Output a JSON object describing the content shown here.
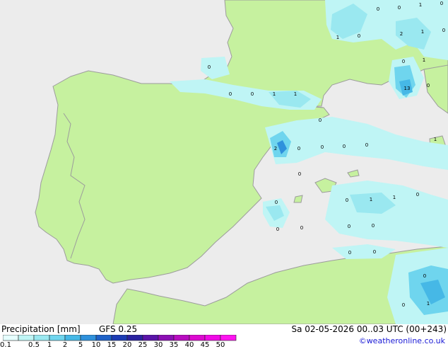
{
  "legend": {
    "title": "Precipitation [mm]",
    "model": "GFS 0.25",
    "colors": [
      "#e6ffff",
      "#bff5f5",
      "#9ae8f0",
      "#6fd5ee",
      "#46b8e6",
      "#2f91dc",
      "#1e62c8",
      "#1c3cb4",
      "#2a22a0",
      "#5a14a8",
      "#8c0fb4",
      "#b80cc0",
      "#dc0ad0",
      "#f00ae6",
      "#ff14f0"
    ],
    "ticks": [
      "0.1",
      "0.5",
      "1",
      "2",
      "5",
      "10",
      "15",
      "20",
      "25",
      "30",
      "35",
      "40",
      "45",
      "50"
    ]
  },
  "valid_time": "Sa 02-05-2026 00..03 UTC (00+243)",
  "credit": "©weatheronline.co.uk",
  "grid_values": [
    {
      "label": "0"
    },
    {
      "label": "0"
    },
    {
      "label": "1"
    },
    {
      "label": "0"
    },
    {
      "label": "1"
    },
    {
      "label": "0"
    },
    {
      "label": "2"
    },
    {
      "label": "1"
    },
    {
      "label": "0"
    },
    {
      "label": "0"
    },
    {
      "label": "1"
    },
    {
      "label": "0"
    },
    {
      "label": "13"
    },
    {
      "label": "0"
    },
    {
      "label": "0"
    },
    {
      "label": "0"
    },
    {
      "label": "1"
    },
    {
      "label": "1"
    },
    {
      "label": "0"
    },
    {
      "label": "2"
    },
    {
      "label": "0"
    },
    {
      "label": "0"
    },
    {
      "label": "0"
    },
    {
      "label": "0"
    },
    {
      "label": "1"
    },
    {
      "label": "0"
    },
    {
      "label": "0"
    },
    {
      "label": "1"
    },
    {
      "label": "1"
    },
    {
      "label": "0"
    },
    {
      "label": "0"
    },
    {
      "label": "0"
    },
    {
      "label": "0"
    },
    {
      "label": "0"
    },
    {
      "label": "0"
    },
    {
      "label": "0"
    },
    {
      "label": "0"
    },
    {
      "label": "0"
    },
    {
      "label": "0"
    },
    {
      "label": "1"
    }
  ]
}
